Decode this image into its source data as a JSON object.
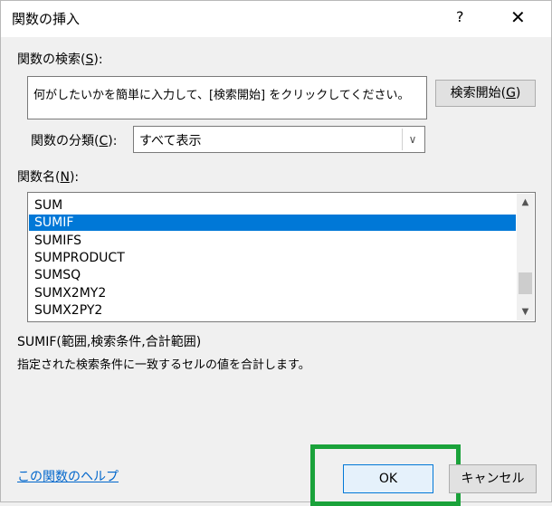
{
  "dialog": {
    "title": "関数の挿入",
    "help_glyph": "?",
    "close_glyph": "✕"
  },
  "search": {
    "label": "関数の検索(",
    "label_key": "S",
    "label_end": "):",
    "text": "何がしたいかを簡単に入力して、[検索開始] をクリックしてください。",
    "button_label": "検索開始(",
    "button_key": "G",
    "button_end": ")"
  },
  "category": {
    "label": "関数の分類(",
    "label_key": "C",
    "label_end": "):",
    "selected": "すべて表示"
  },
  "function_list": {
    "label": "関数名(",
    "label_key": "N",
    "label_end": "):",
    "items": [
      "SUM",
      "SUMIF",
      "SUMIFS",
      "SUMPRODUCT",
      "SUMSQ",
      "SUMX2MY2",
      "SUMX2PY2"
    ],
    "selected_index": 1
  },
  "info": {
    "syntax": "SUMIF(範囲,検索条件,合計範囲)",
    "description": "指定された検索条件に一致するセルの値を合計します。"
  },
  "footer": {
    "help_link": "この関数のヘルプ",
    "ok_label": "OK",
    "cancel_label": "キャンセル"
  },
  "colors": {
    "selection": "#0078d7",
    "highlight": "#1aa23a",
    "link": "#0066cc"
  }
}
